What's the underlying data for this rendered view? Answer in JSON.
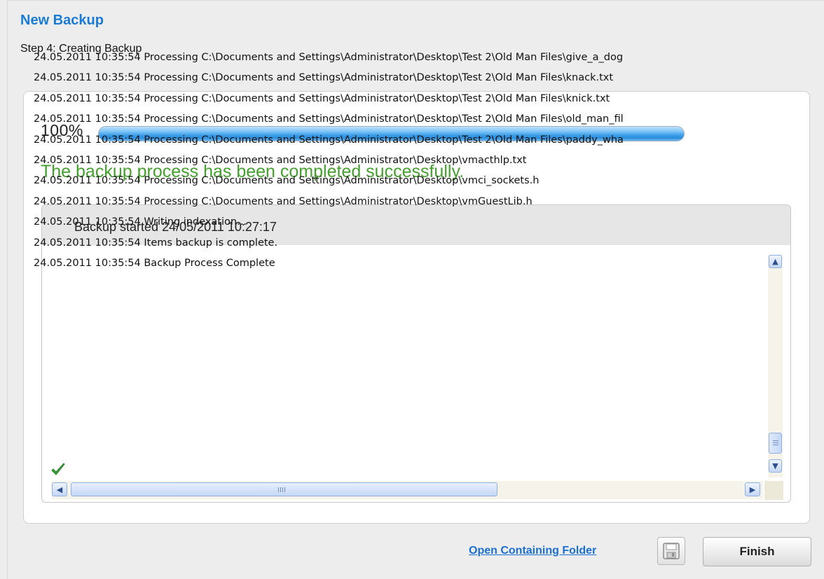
{
  "window": {
    "title": "New Backup",
    "step": "Step 4: Creating Backup"
  },
  "progress": {
    "label": "100%",
    "value": 1.0,
    "status": "The backup process has been completed successfully."
  },
  "log": {
    "header": "Backup started 24/05/2011 10:27:17",
    "lines": [
      "24.05.2011 10:35:54 Processing C:\\Documents and Settings\\Administrator\\Desktop\\Test 2\\Old Man Files\\give_a_dog",
      "24.05.2011 10:35:54 Processing C:\\Documents and Settings\\Administrator\\Desktop\\Test 2\\Old Man Files\\knack.txt",
      "24.05.2011 10:35:54 Processing C:\\Documents and Settings\\Administrator\\Desktop\\Test 2\\Old Man Files\\knick.txt",
      "24.05.2011 10:35:54 Processing C:\\Documents and Settings\\Administrator\\Desktop\\Test 2\\Old Man Files\\old_man_fil",
      "24.05.2011 10:35:54 Processing C:\\Documents and Settings\\Administrator\\Desktop\\Test 2\\Old Man Files\\paddy_wha",
      "24.05.2011 10:35:54 Processing C:\\Documents and Settings\\Administrator\\Desktop\\vmacthlp.txt",
      "24.05.2011 10:35:54 Processing C:\\Documents and Settings\\Administrator\\Desktop\\vmci_sockets.h",
      "24.05.2011 10:35:54 Processing C:\\Documents and Settings\\Administrator\\Desktop\\vmGuestLib.h",
      "24.05.2011 10:35:54 Writing indexation...",
      "24.05.2011 10:35:54 Items backup is complete.",
      "24.05.2011 10:35:54 Backup Process Complete"
    ],
    "complete_icon": "checkmark-icon"
  },
  "actions": {
    "open_folder": "Open Containing Folder",
    "save_icon": "floppy-disk-icon",
    "finish": "Finish"
  },
  "colors": {
    "title": "#1a7bd6",
    "success": "#44a12d",
    "link": "#1a6fd0",
    "progress": "#3d9fe8"
  }
}
